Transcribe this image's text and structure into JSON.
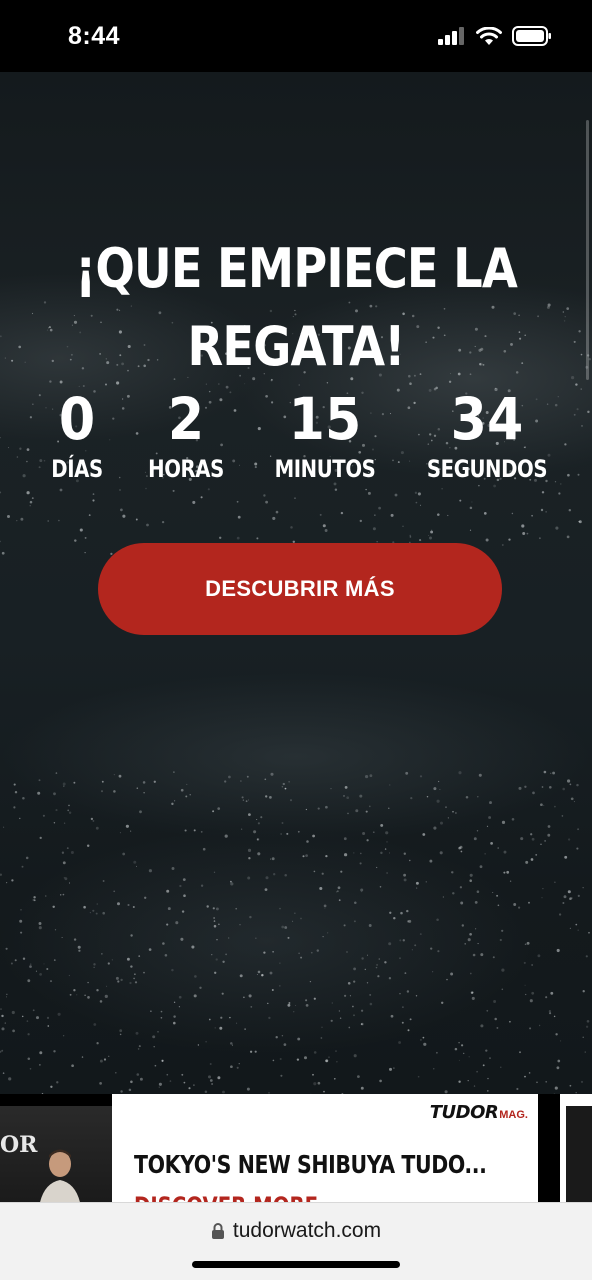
{
  "status_bar": {
    "time": "8:44"
  },
  "hero": {
    "title_line1": "¡QUE EMPIECE LA",
    "title_line2": "REGATA!",
    "countdown": {
      "days": {
        "value": "0",
        "label": "DÍAS"
      },
      "hours": {
        "value": "2",
        "label": "HORAS"
      },
      "minutes": {
        "value": "15",
        "label": "MINUTOS"
      },
      "seconds": {
        "value": "34",
        "label": "SEGUNDOS"
      }
    },
    "cta_label": "DESCUBRIR MÁS"
  },
  "carousel": {
    "prev_card_text": "OR",
    "main_card": {
      "brand": "TUDOR",
      "brand_suffix": "MAG.",
      "title": "TOKYO'S NEW SHIBUYA TUDO...",
      "link": "DISCOVER MORE"
    }
  },
  "browser": {
    "url": "tudorwatch.com"
  },
  "colors": {
    "accent": "#b3261e",
    "hero_bg": "#182024"
  }
}
